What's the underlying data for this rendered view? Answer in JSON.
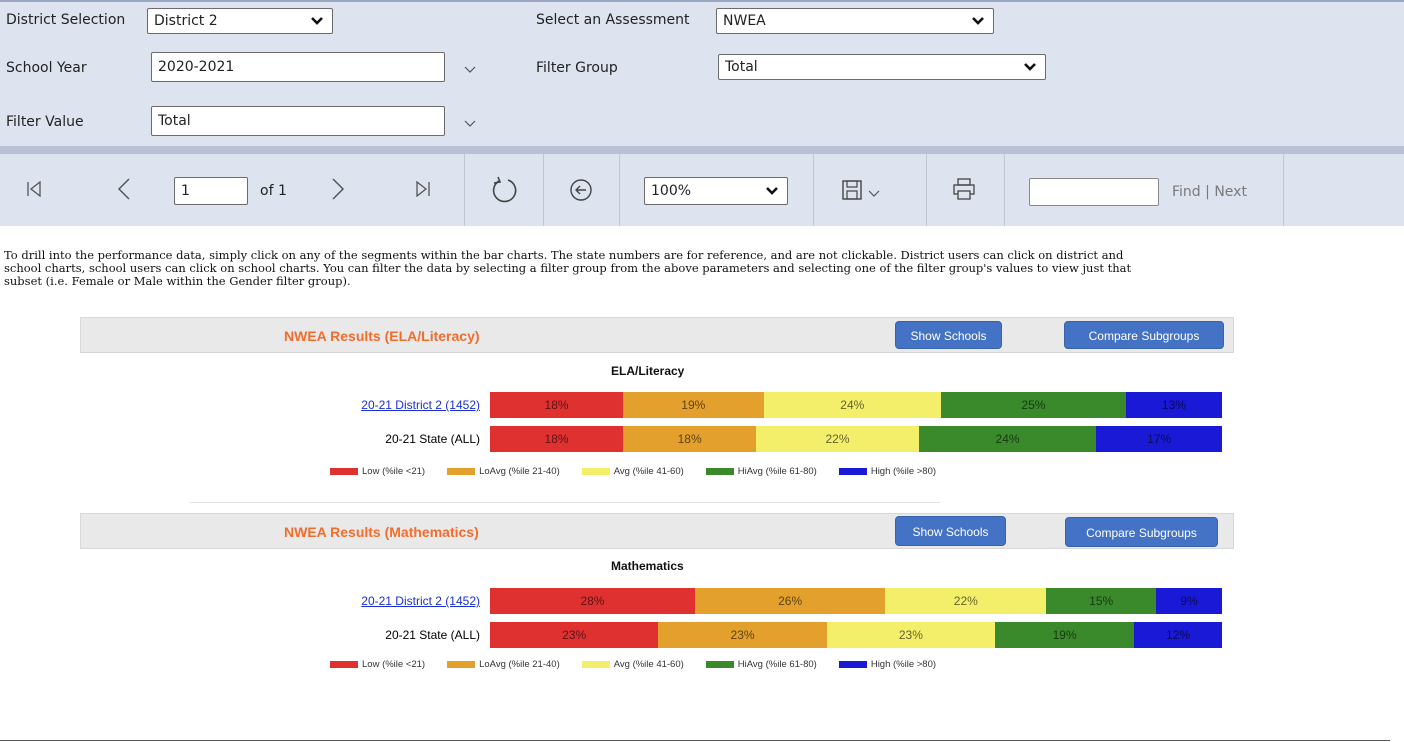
{
  "params": {
    "district_label": "District Selection",
    "district_value": "District 2",
    "assessment_label": "Select an Assessment",
    "assessment_value": "NWEA",
    "year_label": "School Year",
    "year_value": "2020-2021",
    "filter_group_label": "Filter Group",
    "filter_group_value": "Total",
    "filter_value_label": "Filter Value",
    "filter_value_value": "Total"
  },
  "toolbar": {
    "page_value": "1",
    "page_of": "of 1",
    "zoom_value": "100%",
    "find_placeholder": "",
    "find_label": "Find",
    "find_sep": "|",
    "next_label": "Next"
  },
  "intro": {
    "text": "To drill into the performance data, simply click on any of the segments within the bar charts.  The state numbers are for reference, and are not clickable.  District users can click on district and school charts, school users can click on school charts.  You can filter the data by selecting a filter group from the above parameters and selecting one of the filter group's values to view just that subset (i.e. Female or Male within the Gender filter group)."
  },
  "colors": {
    "low": "#e03131",
    "loavg": "#e3a02c",
    "avg": "#f4ef6a",
    "hiavg": "#3a8a2c",
    "high": "#1919d6",
    "accent_title": "#f26d2c",
    "button": "#4472c4"
  },
  "sections": [
    {
      "title": "NWEA Results (ELA/Literacy)",
      "show_schools": "Show Schools",
      "compare": "Compare Subgroups",
      "chart_title": "ELA/Literacy"
    },
    {
      "title": "NWEA Results (Mathematics)",
      "show_schools": "Show Schools",
      "compare": "Compare Subgroups",
      "chart_title": "Mathematics"
    }
  ],
  "legend": [
    "Low (%ile <21)",
    "LoAvg (%ile 21-40)",
    "Avg (%ile 41-60)",
    "HiAvg (%ile 61-80)",
    "High (%ile >80)"
  ],
  "chart_data": [
    {
      "type": "bar",
      "stacked": true,
      "orientation": "horizontal",
      "title": "ELA/Literacy",
      "categories": [
        "20-21 District 2 (1452)",
        "20-21 State (ALL)"
      ],
      "series": [
        {
          "name": "Low (%ile <21)",
          "values": [
            18,
            18
          ],
          "labels": [
            "18%",
            "18%"
          ]
        },
        {
          "name": "LoAvg (%ile 21-40)",
          "values": [
            19,
            18
          ],
          "labels": [
            "19%",
            "18%"
          ]
        },
        {
          "name": "Avg (%ile 41-60)",
          "values": [
            24,
            22
          ],
          "labels": [
            "24%",
            "22%"
          ]
        },
        {
          "name": "HiAvg (%ile 61-80)",
          "values": [
            25,
            24
          ],
          "labels": [
            "25%",
            "24%"
          ]
        },
        {
          "name": "High (%ile >80)",
          "values": [
            13,
            17
          ],
          "labels": [
            "13%",
            "17%"
          ]
        }
      ],
      "legend_position": "bottom"
    },
    {
      "type": "bar",
      "stacked": true,
      "orientation": "horizontal",
      "title": "Mathematics",
      "categories": [
        "20-21 District 2 (1452)",
        "20-21 State (ALL)"
      ],
      "series": [
        {
          "name": "Low (%ile <21)",
          "values": [
            28,
            23
          ],
          "labels": [
            "28%",
            "23%"
          ]
        },
        {
          "name": "LoAvg (%ile 21-40)",
          "values": [
            26,
            23
          ],
          "labels": [
            "26%",
            "23%"
          ]
        },
        {
          "name": "Avg (%ile 41-60)",
          "values": [
            22,
            23
          ],
          "labels": [
            "22%",
            "23%"
          ]
        },
        {
          "name": "HiAvg (%ile 61-80)",
          "values": [
            15,
            19
          ],
          "labels": [
            "15%",
            "19%"
          ]
        },
        {
          "name": "High (%ile >80)",
          "values": [
            9,
            12
          ],
          "labels": [
            "9%",
            "12%"
          ]
        }
      ],
      "legend_position": "bottom"
    }
  ]
}
